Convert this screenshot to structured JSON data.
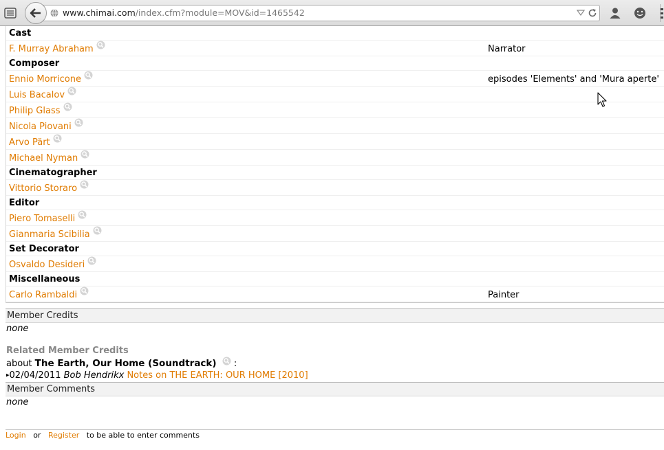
{
  "browser": {
    "url_domain": "www.chimai.com",
    "url_path": "/index.cfm?module=MOV&id=1465542"
  },
  "credits": {
    "rows": [
      {
        "kind": "category",
        "label": "Cast"
      },
      {
        "kind": "person",
        "name": "F. Murray Abraham",
        "role": "Narrator"
      },
      {
        "kind": "category",
        "label": "Composer"
      },
      {
        "kind": "person",
        "name": "Ennio Morricone",
        "role": "episodes 'Elements' and 'Mura aperte'"
      },
      {
        "kind": "person",
        "name": "Luis Bacalov",
        "role": ""
      },
      {
        "kind": "person",
        "name": "Philip Glass",
        "role": ""
      },
      {
        "kind": "person",
        "name": "Nicola Piovani",
        "role": ""
      },
      {
        "kind": "person",
        "name": "Arvo Pärt",
        "role": ""
      },
      {
        "kind": "person",
        "name": "Michael Nyman",
        "role": ""
      },
      {
        "kind": "category",
        "label": "Cinematographer"
      },
      {
        "kind": "person",
        "name": "Vittorio Storaro",
        "role": ""
      },
      {
        "kind": "category",
        "label": "Editor"
      },
      {
        "kind": "person",
        "name": "Piero Tomaselli",
        "role": ""
      },
      {
        "kind": "person",
        "name": "Gianmaria Scibilia",
        "role": ""
      },
      {
        "kind": "category",
        "label": "Set Decorator"
      },
      {
        "kind": "person",
        "name": "Osvaldo Desideri",
        "role": ""
      },
      {
        "kind": "category",
        "label": "Miscellaneous"
      },
      {
        "kind": "person",
        "name": "Carlo Rambaldi",
        "role": "Painter"
      }
    ]
  },
  "member_credits": {
    "title": "Member Credits",
    "value": "none"
  },
  "related": {
    "title": "Related Member Credits",
    "about_prefix": "about",
    "about_title": "The Earth, Our Home (Soundtrack)",
    "about_suffix": ":",
    "bullet": "▸",
    "date": "02/04/2011",
    "author": "Bob Hendrikx",
    "link_text": "Notes on THE EARTH: OUR HOME [2010]"
  },
  "member_comments": {
    "title": "Member Comments",
    "value": "none"
  },
  "login": {
    "login_text": "Login",
    "or_text": "or",
    "register_text": "Register",
    "suffix": "to be able to enter comments"
  },
  "icons": {
    "magnifier": "magnifier-icon",
    "back": "back-arrow-icon",
    "reload": "reload-icon"
  },
  "colors": {
    "link": "#e07b00",
    "related_title": "#888888"
  }
}
